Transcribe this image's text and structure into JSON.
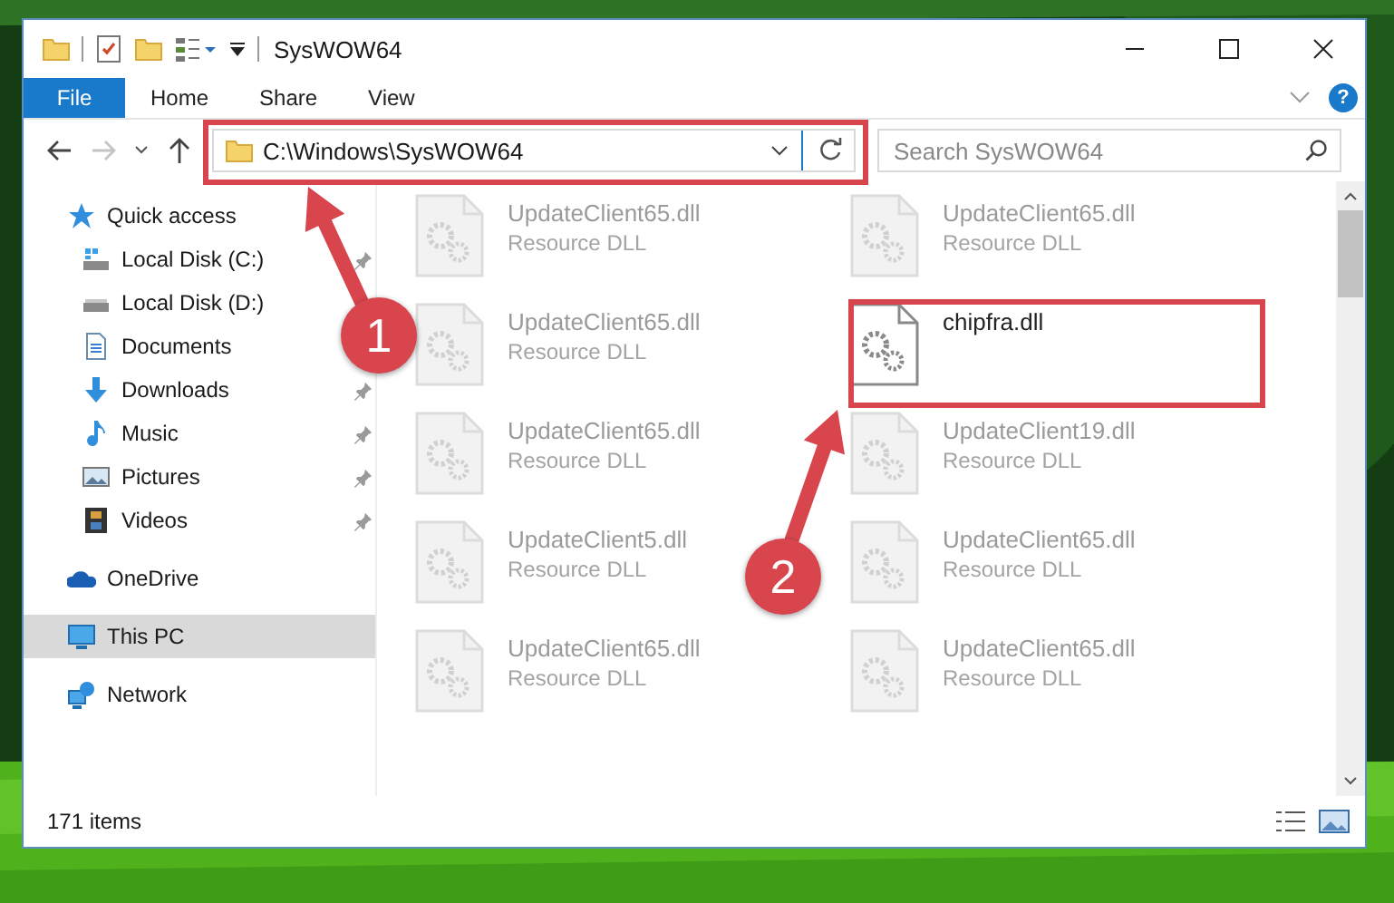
{
  "window": {
    "title": "SysWOW64"
  },
  "ribbon": {
    "file_tab": "File",
    "tabs": [
      "Home",
      "Share",
      "View"
    ],
    "help": "?"
  },
  "address": {
    "path": "C:\\Windows\\SysWOW64"
  },
  "search": {
    "placeholder": "Search SysWOW64"
  },
  "sidebar": {
    "items": [
      {
        "label": "Quick access",
        "kind": "star",
        "selected": false,
        "children": [
          {
            "label": "Local Disk (C:)",
            "kind": "system-drive",
            "pinned": true
          },
          {
            "label": "Local Disk (D:)",
            "kind": "drive",
            "pinned": false
          },
          {
            "label": "Documents",
            "kind": "documents",
            "pinned": false
          },
          {
            "label": "Downloads",
            "kind": "downloads",
            "pinned": true
          },
          {
            "label": "Music",
            "kind": "music",
            "pinned": true
          },
          {
            "label": "Pictures",
            "kind": "pictures",
            "pinned": true
          },
          {
            "label": "Videos",
            "kind": "videos",
            "pinned": true
          }
        ]
      },
      {
        "label": "OneDrive",
        "kind": "cloud",
        "selected": false
      },
      {
        "label": "This PC",
        "kind": "pc",
        "selected": true
      },
      {
        "label": "Network",
        "kind": "network",
        "selected": false
      }
    ]
  },
  "files": [
    {
      "name": "UpdateClient65.dll",
      "type": "Resource DLL",
      "highlighted": false
    },
    {
      "name": "UpdateClient65.dll",
      "type": "Resource DLL",
      "highlighted": false
    },
    {
      "name": "UpdateClient65.dll",
      "type": "Resource DLL",
      "highlighted": false
    },
    {
      "name": "chipfra.dll",
      "highlighted": true
    },
    {
      "name": "UpdateClient65.dll",
      "type": "Resource DLL",
      "highlighted": false
    },
    {
      "name": "UpdateClient19.dll",
      "type": "Resource DLL",
      "highlighted": false
    },
    {
      "name": "UpdateClient5.dll",
      "type": "Resource DLL",
      "highlighted": false
    },
    {
      "name": "UpdateClient65.dll",
      "type": "Resource DLL",
      "highlighted": false
    },
    {
      "name": "UpdateClient65.dll",
      "type": "Resource DLL",
      "highlighted": false
    },
    {
      "name": "UpdateClient65.dll",
      "type": "Resource DLL",
      "highlighted": false
    }
  ],
  "status_bar": {
    "count": "171 items"
  },
  "annotations": [
    {
      "number": "1"
    },
    {
      "number": "2"
    }
  ]
}
